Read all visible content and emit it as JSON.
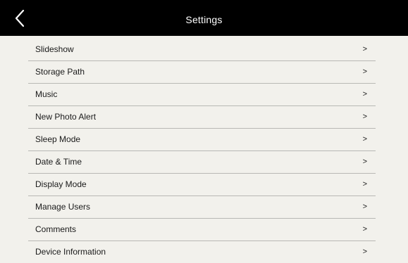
{
  "header": {
    "title": "Settings",
    "back_icon": "back-chevron-icon"
  },
  "settings": {
    "chevron": ">",
    "items": [
      {
        "label": "Slideshow"
      },
      {
        "label": "Storage Path"
      },
      {
        "label": "Music"
      },
      {
        "label": "New Photo Alert"
      },
      {
        "label": "Sleep Mode"
      },
      {
        "label": "Date & Time"
      },
      {
        "label": "Display Mode"
      },
      {
        "label": "Manage Users"
      },
      {
        "label": "Comments"
      },
      {
        "label": "Device Information"
      }
    ]
  },
  "colors": {
    "header_bg": "#000000",
    "page_bg": "#f2f1ec",
    "divider": "#b8b8b4",
    "text": "#1a1a1a"
  }
}
